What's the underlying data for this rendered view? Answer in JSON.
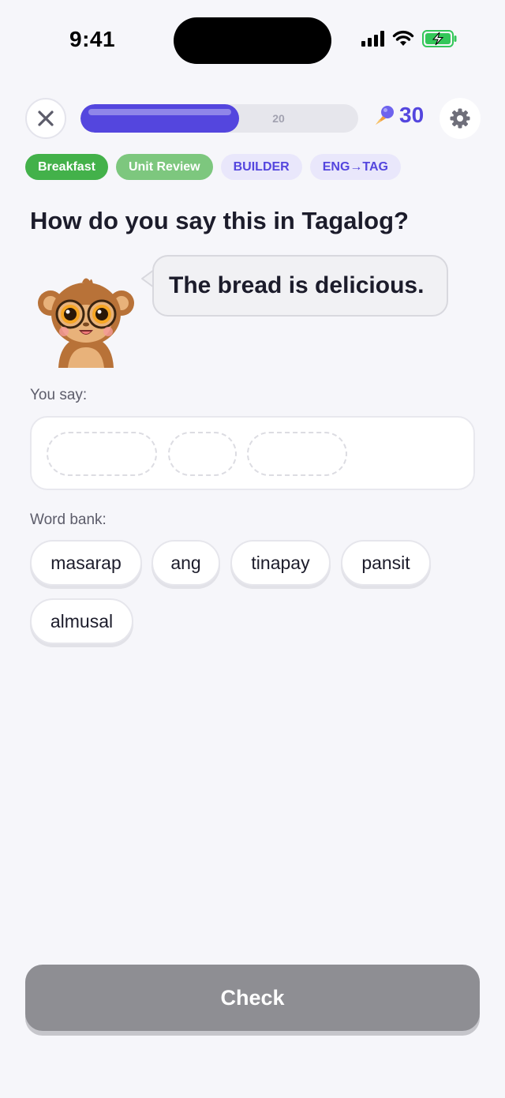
{
  "status_bar": {
    "time": "9:41"
  },
  "top_bar": {
    "progress_fraction": 0.57,
    "progress_label": "20",
    "gem_count": "30",
    "icons": [
      "close-icon",
      "gem-icon",
      "gear-icon"
    ]
  },
  "tags": [
    "Breakfast",
    "Unit Review",
    "BUILDER",
    "ENG→TAG"
  ],
  "prompt": {
    "title": "How do you say this in Tagalog?",
    "sentence": "The bread is delicious."
  },
  "answer": {
    "label": "You say:",
    "slots": 3
  },
  "word_bank": {
    "label": "Word bank:",
    "words": [
      "masarap",
      "ang",
      "tinapay",
      "pansit",
      "almusal"
    ]
  },
  "check_button": {
    "label": "Check"
  },
  "colors": {
    "accent": "#5446de",
    "tag_green": "#43b14a",
    "tag_lightgreen": "#7dc77e",
    "check_disabled": "#8e8e93"
  }
}
